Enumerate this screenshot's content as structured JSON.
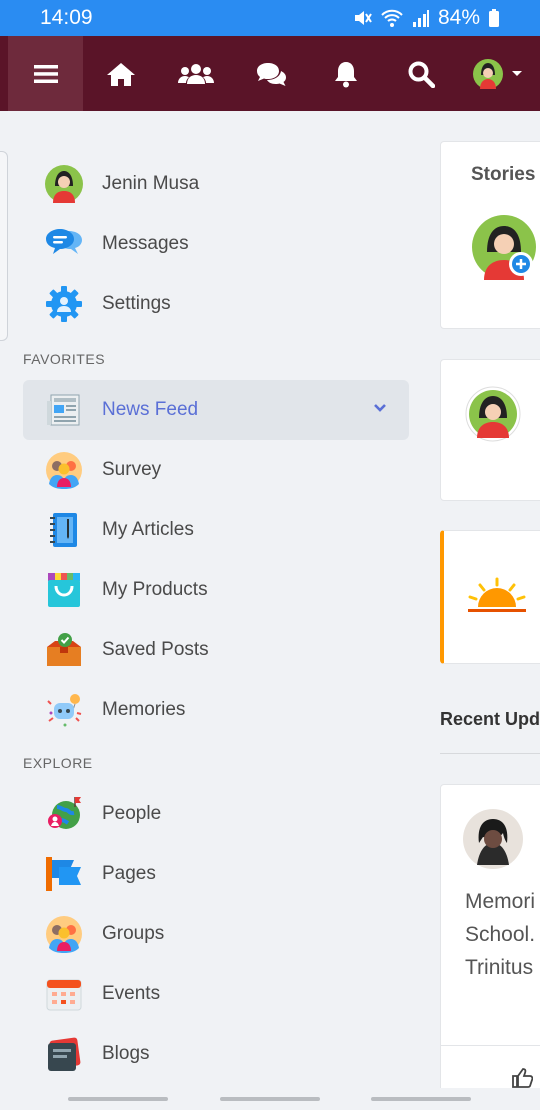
{
  "status_bar": {
    "time": "14:09",
    "battery": "84%",
    "icons": [
      "mute-icon",
      "wifi-icon",
      "signal-icon",
      "battery-icon"
    ]
  },
  "top_nav": {
    "items": [
      "menu-icon",
      "home-icon",
      "friends-icon",
      "chat-icon",
      "bell-icon",
      "search-icon",
      "profile-avatar"
    ],
    "colors": {
      "bar": "#5a1428",
      "active": "#6e2a3c"
    }
  },
  "sidebar": {
    "profile": {
      "label": "Jenin Musa"
    },
    "messages": {
      "label": "Messages"
    },
    "settings": {
      "label": "Settings"
    },
    "favorites_heading": "FAVORITES",
    "favorites": [
      {
        "label": "News Feed",
        "icon": "newspaper-icon",
        "active": true
      },
      {
        "label": "Survey",
        "icon": "survey-icon"
      },
      {
        "label": "My Articles",
        "icon": "notebook-icon"
      },
      {
        "label": "My Products",
        "icon": "shopping-bag-icon"
      },
      {
        "label": "Saved Posts",
        "icon": "saved-box-icon"
      },
      {
        "label": "Memories",
        "icon": "memories-icon"
      }
    ],
    "explore_heading": "EXPLORE",
    "explore": [
      {
        "label": "People",
        "icon": "globe-people-icon"
      },
      {
        "label": "Pages",
        "icon": "flag-icon"
      },
      {
        "label": "Groups",
        "icon": "groups-icon"
      },
      {
        "label": "Events",
        "icon": "calendar-icon"
      },
      {
        "label": "Blogs",
        "icon": "book-icon"
      }
    ]
  },
  "right_column": {
    "stories_title": "Stories",
    "recent_title": "Recent Upd",
    "post_text": [
      "Memori",
      "School.",
      "Trinitus"
    ]
  }
}
